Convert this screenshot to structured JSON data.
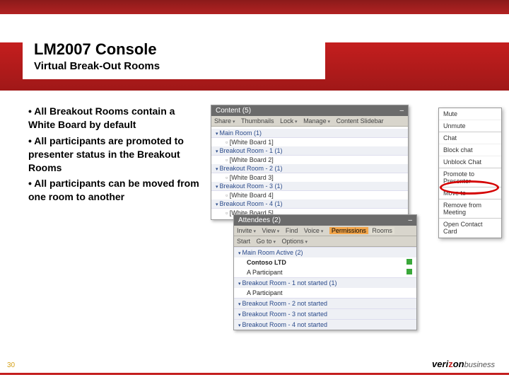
{
  "header": {
    "title": "LM2007 Console",
    "subtitle": "Virtual Break-Out Rooms"
  },
  "bullets": [
    "All Breakout Rooms contain a White Board by default",
    "All participants are promoted to presenter status in the Breakout Rooms",
    "All participants can be moved from one room to another"
  ],
  "content_panel": {
    "title": "Content (5)",
    "toolbar": [
      "Share",
      "Thumbnails",
      "Lock",
      "Manage",
      "Content Slidebar"
    ],
    "groups": [
      {
        "name": "Main Room (1)",
        "items": [
          "[White Board 1]"
        ]
      },
      {
        "name": "Breakout Room - 1 (1)",
        "items": [
          "[White Board 2]"
        ]
      },
      {
        "name": "Breakout Room - 2 (1)",
        "items": [
          "[White Board 3]"
        ]
      },
      {
        "name": "Breakout Room - 3 (1)",
        "items": [
          "[White Board 4]"
        ]
      },
      {
        "name": "Breakout Room - 4 (1)",
        "items": [
          "[White Board 5]"
        ]
      }
    ]
  },
  "context_menu": {
    "items": [
      "Mute",
      "Unmute",
      "Chat",
      "Block chat",
      "Unblock Chat",
      "Promote to Presenter",
      "Move to",
      "Remove from Meeting",
      "Open Contact Card"
    ],
    "highlighted_index": 6
  },
  "attendees_panel": {
    "title": "Attendees (2)",
    "toolbar1": {
      "left": [
        "Invite",
        "View",
        "Find",
        "Voice"
      ],
      "right_buttons": [
        "Permissions",
        "Rooms"
      ]
    },
    "toolbar2": [
      "Start",
      "Go to",
      "Options"
    ],
    "groups": [
      {
        "name": "Main Room Active (2)",
        "rows": [
          {
            "label": "Contoso LTD",
            "bold": true,
            "status": "green"
          },
          {
            "label": "A Participant",
            "status": "green"
          }
        ]
      },
      {
        "name": "Breakout Room - 1 not started (1)",
        "rows": [
          {
            "label": "A Participant"
          }
        ]
      },
      {
        "name": "Breakout Room - 2 not started",
        "rows": []
      },
      {
        "name": "Breakout Room - 3 not started",
        "rows": []
      },
      {
        "name": "Breakout Room - 4 not started",
        "rows": []
      }
    ]
  },
  "footer": {
    "page": "30",
    "logo_brand": "veri",
    "logo_mark": "z",
    "logo_brand2": "on",
    "logo_sub": "business"
  }
}
